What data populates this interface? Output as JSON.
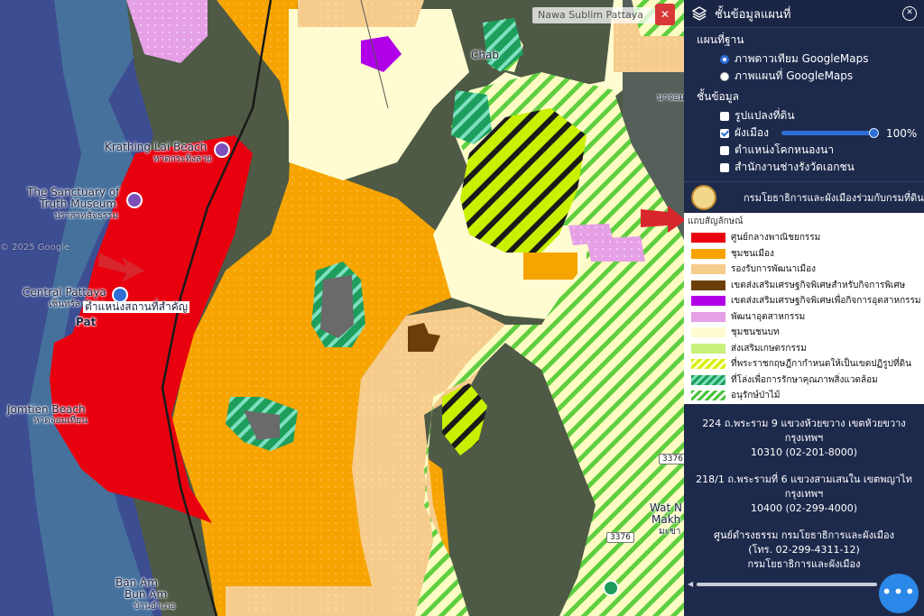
{
  "map": {
    "search_placeholder": "Nawa Sublim Pattaya",
    "labels": {
      "krathing_lai": "Krathing Lai Beach",
      "krathing_lai_th": "หาดกระทิงลาย",
      "sanctuary_1": "The Sanctuary of",
      "sanctuary_2": "Truth Museum",
      "sanctuary_th": "ปราสาทสัจธรรม",
      "central": "Central Pattaya",
      "central_th": "เซ็นทรัล พัทยา",
      "pat": "Pat",
      "jomtien": "Jomtien Beach",
      "jomtien_th": "หาดจอมเทียน",
      "ban_am": "Ban Am",
      "ban_am_2": "Bun Am",
      "ban_am_th": "บ้านอำเภอ",
      "chab": "Chab",
      "wat": "Wat N",
      "makh": "Makh",
      "makh_th": "มะขา",
      "copyright": "© 2025 Google",
      "poi_tip": "ตำแหน่งสถานที่สำคัญ",
      "shield_3376": "3376",
      "shield_3376_b": "3376",
      "top_right": "นาจอม"
    }
  },
  "panel": {
    "title": "ชั้นข้อมูลแผนที่",
    "basemap_title": "แผนที่ฐาน",
    "basemaps": [
      {
        "label": "ภาพดาวเทียม GoogleMaps",
        "selected": true
      },
      {
        "label": "ภาพแผนที่ GoogleMaps",
        "selected": false
      }
    ],
    "layers_title": "ชั้นข้อมูล",
    "layers": [
      {
        "label": "รูปแปลงที่ดิน",
        "checked": false
      },
      {
        "label": "ผังเมือง",
        "checked": true,
        "opacity": "100%"
      },
      {
        "label": "ตำแหน่งโคกหนองนา",
        "checked": false
      },
      {
        "label": "สำนักงานช่างรังวัดเอกชน",
        "checked": false
      }
    ],
    "department": "กรมโยธาธิการและผังเมืองร่วมกับกรมที่ดิน",
    "legend_title": "แถบสัญลักษณ์",
    "legend": [
      {
        "label": "ศูนย์กลางพาณิชยกรรม",
        "color": "#e8000f"
      },
      {
        "label": "ชุมชนเมือง",
        "color": "#f7a400"
      },
      {
        "label": "รองรับการพัฒนาเมือง",
        "color": "#f6cc8c"
      },
      {
        "label": "เขตส่งเสริมเศรษฐกิจพิเศษสำหรับกิจการพิเศษ",
        "color": "#6b3e0a"
      },
      {
        "label": "เขตส่งเสริมเศรษฐกิจพิเศษเพื่อกิจการอุตสาหกรรม",
        "color": "#b100e8"
      },
      {
        "label": "พัฒนาอุตสาหกรรม",
        "color": "#e6a0e6"
      },
      {
        "label": "ชุมชนชนบท",
        "color": "#fefcd0"
      },
      {
        "label": "ส่งเสริมเกษตรกรรม",
        "color": "#c8f07a"
      },
      {
        "label": "ที่พระราชกฤษฎีกากำหนดให้เป็นเขตปฏิรูปที่ดิน",
        "color": "#d4f000",
        "pattern": "hatch-yellow"
      },
      {
        "label": "ที่โล่งเพื่อการรักษาคุณภาพสิ่งแวดล้อม",
        "color": "#1d9e5c",
        "pattern": "hatch-green"
      },
      {
        "label": "อนุรักษ์ป่าไม้",
        "color": "#49c43a",
        "pattern": "hatch-lime"
      }
    ],
    "addresses": [
      "224 ถ.พระราม 9 แขวงห้วยขวาง เขตห้วยขวาง กรุงเทพฯ\n10310 (02-201-8000)",
      "218/1 ถ.พระรามที่ 6 แขวงสามเสนใน เขตพญาไท กรุงเทพฯ\n10400 (02-299-4000)",
      "ศูนย์ดำรงธรรม กรมโยธาธิการและผังเมือง\n(โทร. 02-299-4311-12)\nกรมโยธาธิการและผังเมือง"
    ],
    "more_label": "•••"
  },
  "colors": {
    "panel_bg": "#1e2a4c",
    "accent": "#2d6fd6",
    "sea": "#3a4a8a"
  }
}
